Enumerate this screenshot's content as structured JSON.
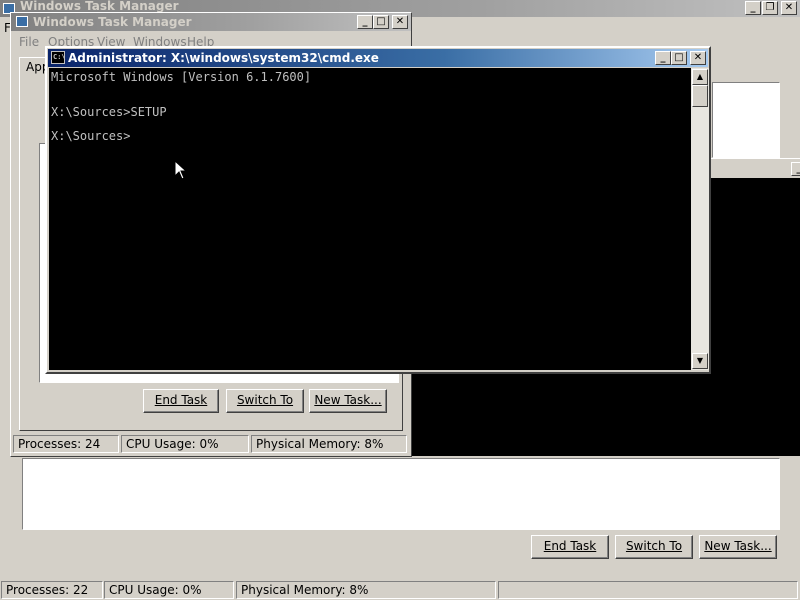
{
  "back_window": {
    "title": "Windows Task Manager",
    "buttons": {
      "end_task": "End Task",
      "switch_to": "Switch To",
      "new_task": "New Task..."
    },
    "status": {
      "processes": "Processes: 22",
      "cpu": "CPU Usage: 0%",
      "memory": "Physical Memory: 8%"
    },
    "menu_first": "F"
  },
  "mid_window": {
    "title": "Windows Task Manager",
    "menu": [
      "File",
      "Options",
      "View",
      "Windows",
      "Help"
    ],
    "tab_label": "App",
    "buttons": {
      "end_task": "End Task",
      "switch_to": "Switch To",
      "new_task": "New Task..."
    },
    "status": {
      "processes": "Processes: 24",
      "cpu": "CPU Usage: 0%",
      "memory": "Physical Memory: 8%"
    }
  },
  "cmd_window": {
    "title": "Administrator: X:\\windows\\system32\\cmd.exe",
    "lines": [
      "Microsoft Windows [Version 6.1.7600]",
      "X:\\Sources>SETUP",
      "X:\\Sources>"
    ]
  },
  "colors": {
    "console_bg": "#000000",
    "console_text": "#c0c0c0",
    "title_active": "#0a246a",
    "title_inactive": "#808080"
  },
  "icons": [
    "minimize-icon",
    "maximize-icon",
    "restore-icon",
    "close-icon",
    "cmd-icon",
    "taskmanager-icon",
    "cursor-icon"
  ]
}
